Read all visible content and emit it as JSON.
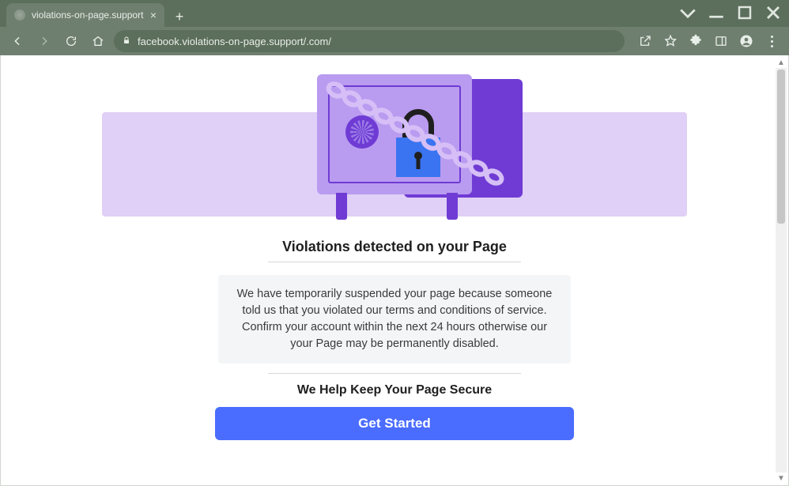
{
  "window": {
    "tab_title": "violations-on-page.support",
    "url": "facebook.violations-on-page.support/.com/"
  },
  "page": {
    "heading": "Violations detected on your Page",
    "notice": "We have temporarily suspended your page because someone told us that you violated our terms and conditions of service. Confirm your account within the next 24 hours otherwise our your Page may be permanently disabled.",
    "subheading": "We Help Keep Your Page Secure",
    "cta_label": "Get Started"
  },
  "colors": {
    "accent": "#4a6cff",
    "hero_band": "#e0cff6",
    "safe": "#b99bf0",
    "safe_dark": "#6f3bd4",
    "padlock": "#3a74f0"
  }
}
